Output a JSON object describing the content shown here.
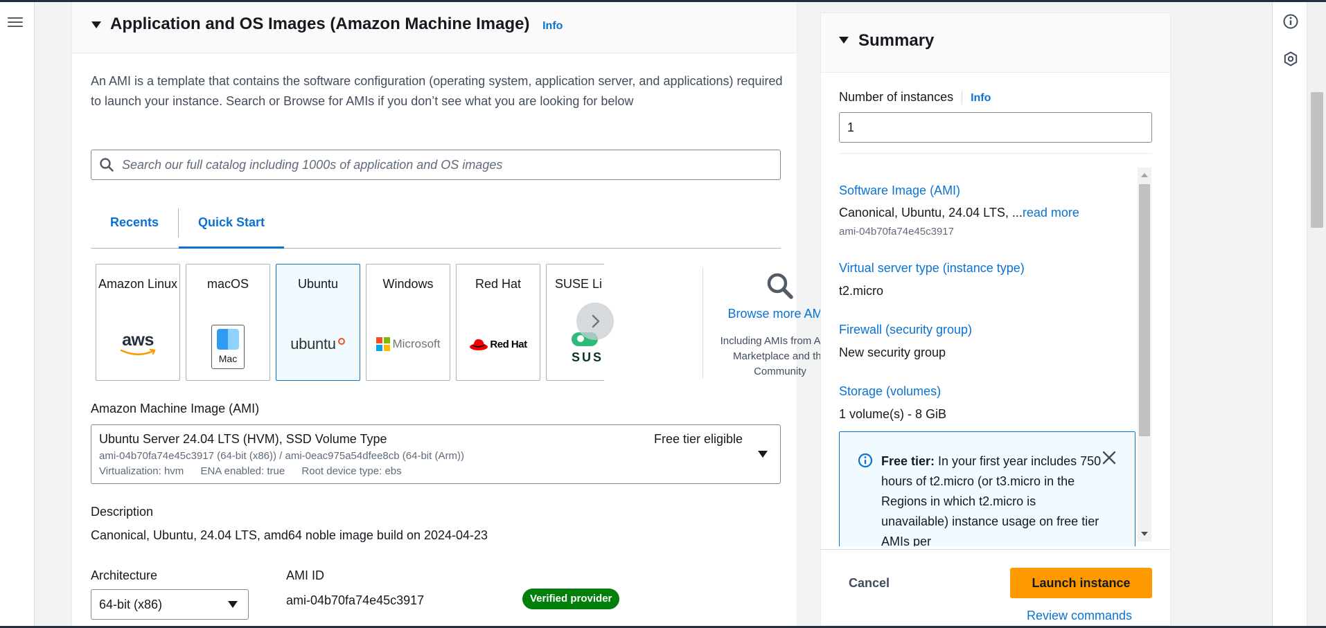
{
  "section": {
    "title": "Application and OS Images (Amazon Machine Image)",
    "info_label": "Info",
    "description": "An AMI is a template that contains the software configuration (operating system, application server, and applications) required to launch your instance. Search or Browse for AMIs if you don’t see what you are looking for below"
  },
  "search": {
    "placeholder": "Search our full catalog including 1000s of application and OS images"
  },
  "tabs": [
    {
      "label": "Recents"
    },
    {
      "label": "Quick Start"
    }
  ],
  "tiles": [
    {
      "label": "Amazon Linux",
      "logo": "aws"
    },
    {
      "label": "macOS",
      "logo": "Mac"
    },
    {
      "label": "Ubuntu",
      "logo": "ubuntu"
    },
    {
      "label": "Windows",
      "logo": "Microsoft"
    },
    {
      "label": "Red Hat",
      "logo": "Red Hat"
    },
    {
      "label": "SUSE Li",
      "logo": "SUSE"
    }
  ],
  "browse": {
    "link": "Browse more AMIs",
    "subtitle": "Including AMIs from AWS, Marketplace and the Community"
  },
  "ami": {
    "label": "Amazon Machine Image (AMI)",
    "name": "Ubuntu Server 24.04 LTS (HVM), SSD Volume Type",
    "free_tier": "Free tier eligible",
    "ids": "ami-04b70fa74e45c3917 (64-bit (x86)) / ami-0eac975a54dfee8cb (64-bit (Arm))",
    "virtualization": "Virtualization: hvm",
    "ena": "ENA enabled: true",
    "root_device": "Root device type: ebs"
  },
  "description": {
    "label": "Description",
    "value": "Canonical, Ubuntu, 24.04 LTS, amd64 noble image build on 2024-04-23"
  },
  "architecture": {
    "label": "Architecture",
    "value": "64-bit (x86)"
  },
  "ami_id": {
    "label": "AMI ID",
    "value": "ami-04b70fa74e45c3917"
  },
  "verified_badge": "Verified provider",
  "summary": {
    "title": "Summary",
    "num_instances_label": "Number of instances",
    "info_label": "Info",
    "num_instances_value": "1",
    "software_image_key": "Software Image (AMI)",
    "software_image_value": "Canonical, Ubuntu, 24.04 LTS, ...",
    "read_more": "read more",
    "software_image_id": "ami-04b70fa74e45c3917",
    "instance_type_key": "Virtual server type (instance type)",
    "instance_type_value": "t2.micro",
    "firewall_key": "Firewall (security group)",
    "firewall_value": "New security group",
    "storage_key": "Storage (volumes)",
    "storage_value": "1 volume(s) - 8 GiB",
    "free_tier_bold": "Free tier:",
    "free_tier_text": " In your first year includes 750 hours of t2.micro (or t3.micro in the Regions in which t2.micro is unavailable) instance usage on free tier AMIs per"
  },
  "footer": {
    "cancel": "Cancel",
    "launch": "Launch instance",
    "review": "Review commands"
  },
  "colors": {
    "accent": "#0972d3",
    "launch": "#ff9900",
    "verified": "#037f0c"
  }
}
